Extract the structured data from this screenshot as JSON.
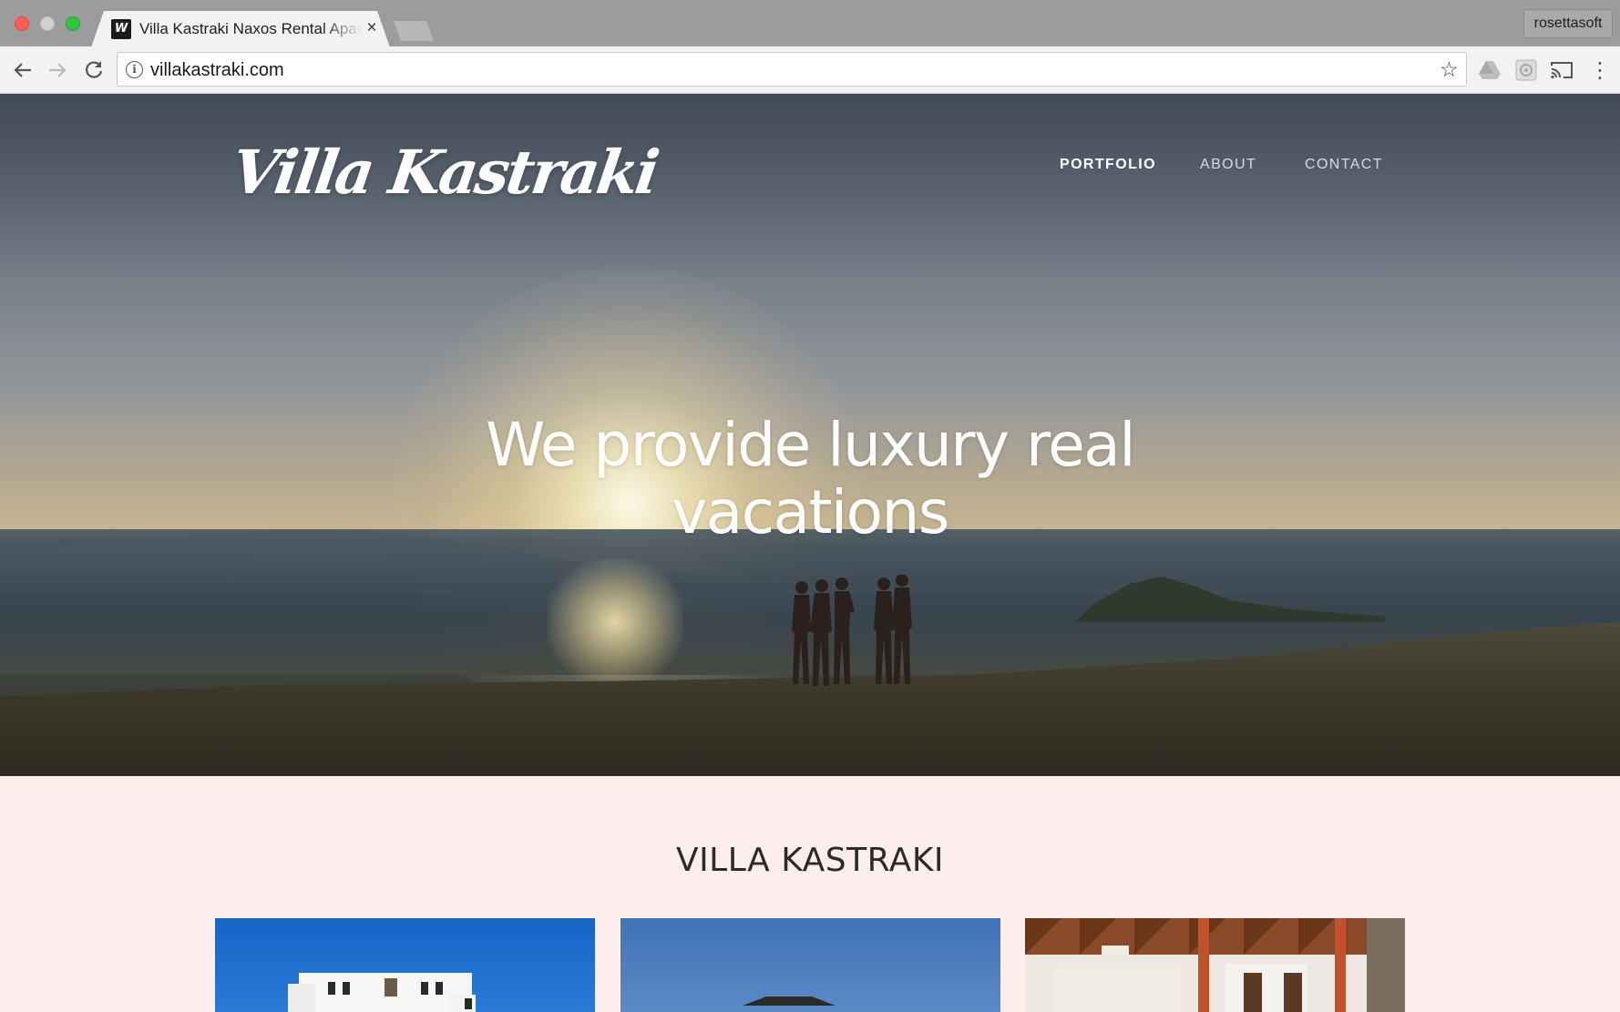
{
  "browser": {
    "tab_title": "Villa Kastraki Naxos Rental Apartments",
    "tab_favicon": "W",
    "tab_close": "×",
    "profile_name": "rosettasoft",
    "url": "villakastraki.com",
    "icons": {
      "back": "arrow-left-icon",
      "forward": "arrow-right-icon",
      "reload": "reload-icon",
      "info": "info-icon",
      "bookmark": "star-icon",
      "drive": "drive-icon",
      "extension": "gear-icon",
      "cast": "cast-icon",
      "menu": "kebab-menu-icon"
    }
  },
  "site": {
    "logo": "Villa Kastraki",
    "nav": {
      "portfolio": "PORTFOLIO",
      "about": "ABOUT",
      "contact": "CONTACT"
    },
    "hero_headline": "We provide luxury real vacations",
    "section_title": "VILLA KASTRAKI",
    "colors": {
      "section_background": "#fdeeed",
      "nav_active": "#ffffff",
      "nav_inactive": "#d6dae0"
    }
  }
}
